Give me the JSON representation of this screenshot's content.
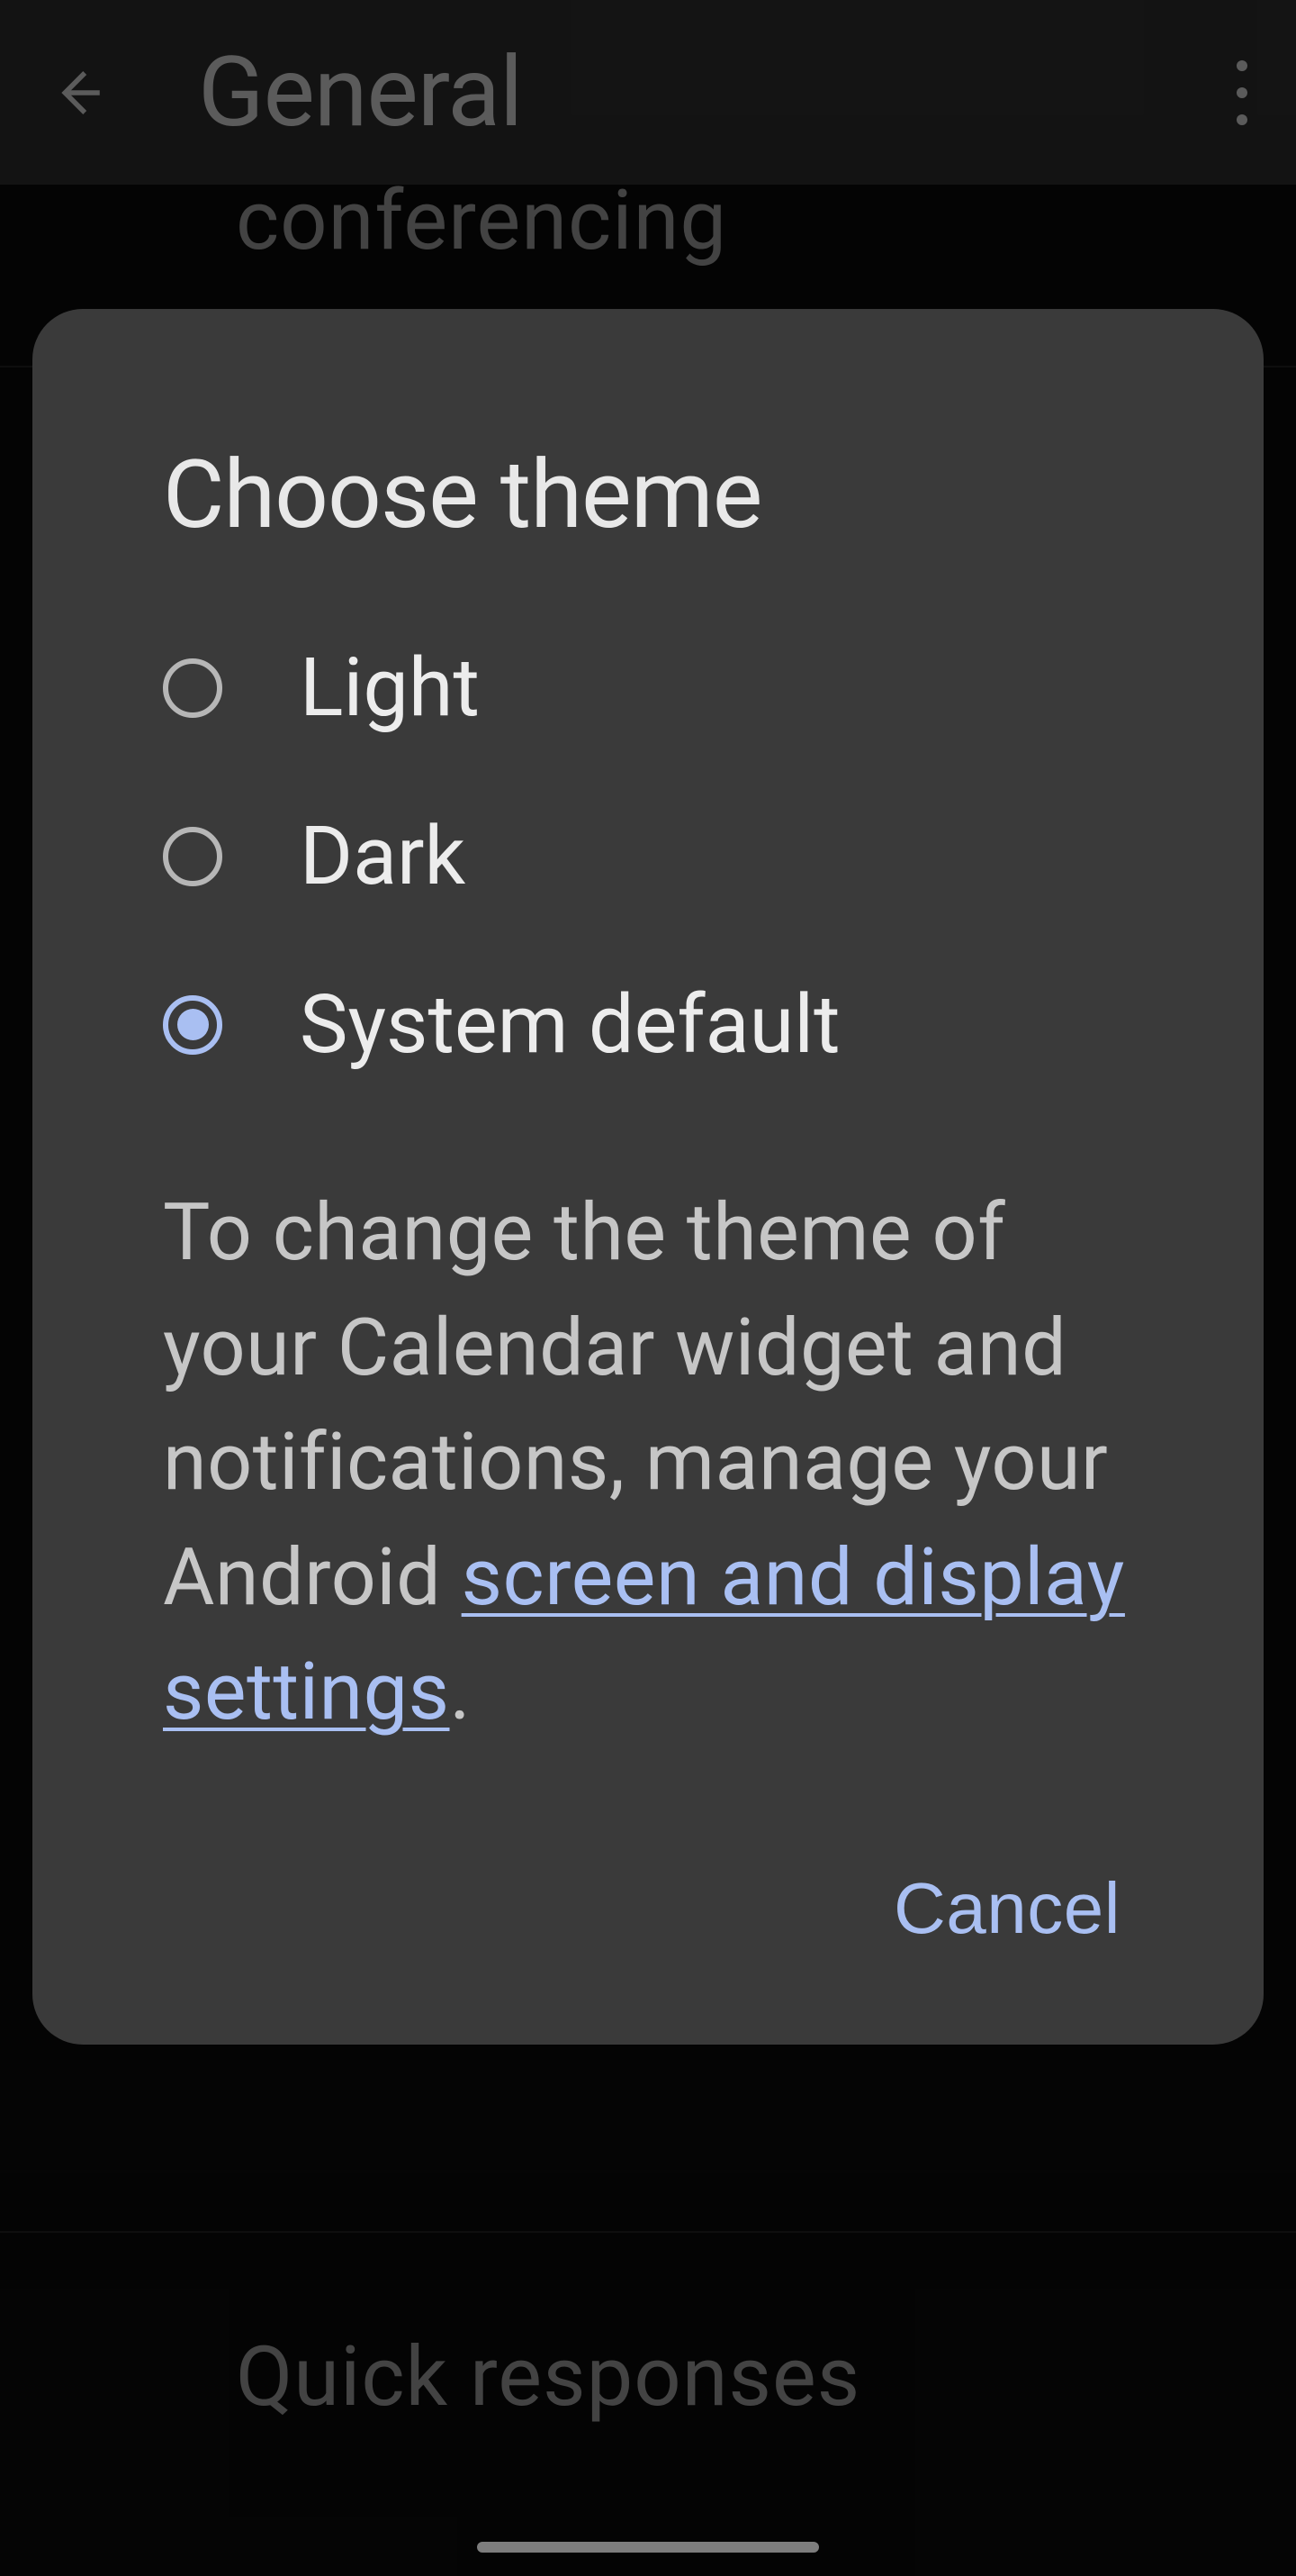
{
  "appbar": {
    "title": "General"
  },
  "background": {
    "top_partial": "conferencing",
    "bottom_item": "Quick responses"
  },
  "dialog": {
    "title": "Choose theme",
    "options": [
      {
        "label": "Light",
        "selected": false
      },
      {
        "label": "Dark",
        "selected": false
      },
      {
        "label": "System default",
        "selected": true
      }
    ],
    "body_pre": "To change the theme of your Calendar widget and notifications, manage your Android ",
    "link_text": "screen and display settings",
    "body_post": ".",
    "cancel": "Cancel"
  }
}
